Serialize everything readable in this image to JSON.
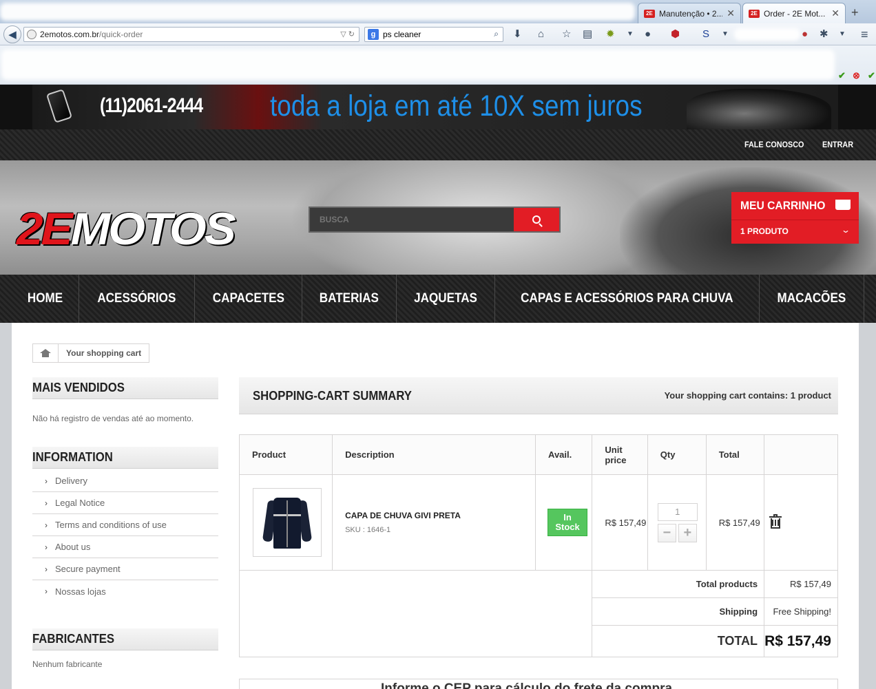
{
  "browser": {
    "tabs": [
      {
        "label": "Manutenção • 2...",
        "favicon": "2E",
        "active": false
      },
      {
        "label": "Order - 2E Mot...",
        "favicon": "2E",
        "active": true
      }
    ],
    "new_tab_icon": "plus-icon",
    "url_host": "2emotos.com.br",
    "url_path": "/quick-order",
    "search_query": "ps cleaner"
  },
  "banner": {
    "phone": "(11)2061-2444",
    "slogan": "toda a loja em até 10X sem juros"
  },
  "util": {
    "contact": "FALE CONOSCO",
    "login": "ENTRAR"
  },
  "header": {
    "logo_red": "2E",
    "logo_white": "MOTOS",
    "search_placeholder": "BUSCA",
    "cart_title": "MEU CARRINHO",
    "cart_count": "1 PRODUTO"
  },
  "nav": [
    "HOME",
    "ACESSÓRIOS",
    "CAPACETES",
    "BATERIAS",
    "JAQUETAS",
    "CAPAS E ACESSÓRIOS PARA CHUVA",
    "MACACÕES"
  ],
  "breadcrumb": "Your shopping cart",
  "sidebar": {
    "best_title": "MAIS VENDIDOS",
    "best_text": "Não há registro de vendas até ao momento.",
    "info_title": "INFORMATION",
    "info_items": [
      "Delivery",
      "Legal Notice",
      "Terms and conditions of use",
      "About us",
      "Secure payment",
      "Nossas lojas"
    ],
    "brands_title": "FABRICANTES",
    "brands_text": "Nenhum fabricante"
  },
  "summary": {
    "title": "SHOPPING-CART SUMMARY",
    "contains": "Your shopping cart contains: 1 product"
  },
  "cart_table": {
    "headers": {
      "product": "Product",
      "description": "Description",
      "avail": "Avail.",
      "unit_price_1": "Unit",
      "unit_price_2": "price",
      "qty": "Qty",
      "total": "Total"
    },
    "item": {
      "name": "CAPA DE CHUVA GIVI PRETA",
      "sku": "SKU : 1646-1",
      "stock_1": "In",
      "stock_2": "Stock",
      "unit_price": "R$ 157,49",
      "qty": "1",
      "minus": "−",
      "plus": "+",
      "total": "R$ 157,49"
    },
    "totals": {
      "products_label": "Total products",
      "products_value": "R$ 157,49",
      "shipping_label": "Shipping",
      "shipping_value": "Free Shipping!",
      "grand_label": "TOTAL",
      "grand_value": "R$ 157,49"
    }
  },
  "next_panel_text": "Informe o CEP para cálculo do frete da compra"
}
